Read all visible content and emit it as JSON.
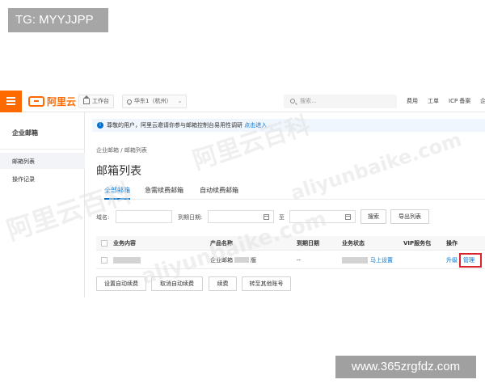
{
  "overlay": {
    "tg_label": "TG: MYYJJPP",
    "footer_url": "www.365zrgfdz.com"
  },
  "topbar": {
    "brand": "阿里云",
    "workbench": "工作台",
    "region": "华东1（杭州）",
    "search_placeholder": "搜索...",
    "links": [
      "费用",
      "工单",
      "ICP 备案",
      "企"
    ]
  },
  "sidebar": {
    "title": "企业邮箱",
    "items": [
      {
        "label": "邮箱列表",
        "active": true
      },
      {
        "label": "操作记录",
        "active": false
      }
    ]
  },
  "notice": {
    "text": "尊敬的用户，阿里云邀请你参与邮箱控制台易用性调研",
    "link": "点击进入"
  },
  "breadcrumb": {
    "root": "企业邮箱",
    "sep": "/",
    "current": "邮箱列表"
  },
  "page_title": "邮箱列表",
  "tabs": [
    {
      "label": "全部邮箱",
      "active": true
    },
    {
      "label": "急需续费邮箱",
      "active": false
    },
    {
      "label": "自动续费邮箱",
      "active": false
    }
  ],
  "filters": {
    "domain_label": "域名:",
    "expire_label": "到期日期:",
    "to_label": "至",
    "search_button": "搜索",
    "export_button": "导出列表"
  },
  "table": {
    "headers": [
      "业务内容",
      "产品名称",
      "到期日期",
      "业务状态",
      "VIP服务包",
      "操作"
    ],
    "row": {
      "product_prefix": "企业邮箱",
      "product_suffix": "版",
      "expire": "--",
      "status_link": "马上设置",
      "action_upgrade": "升级",
      "action_manage": "管理"
    }
  },
  "bottom_buttons": [
    "设置自动续费",
    "取消自动续费",
    "续费",
    "转至其他账号"
  ],
  "watermark": {
    "cn": "阿里云百科",
    "en": "aliyunbaike.com"
  },
  "colors": {
    "brand_orange": "#ff6a00",
    "link_blue": "#0070cc",
    "highlight_red": "#d9262c"
  }
}
